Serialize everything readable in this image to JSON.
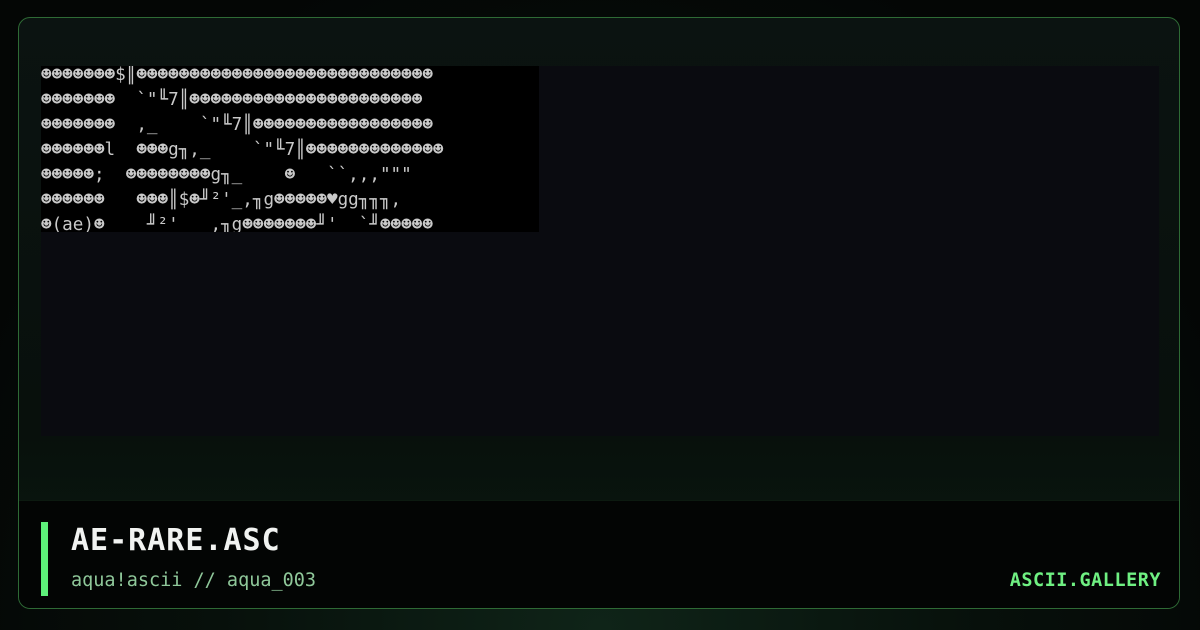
{
  "art": {
    "file_title": "AE-RARE.ASC",
    "ascii_lines": [
      "☻☻☻☻☻☻☻$║☻☻☻☻☻☻☻☻☻☻☻☻☻☻☻☻☻☻☻☻☻☻☻☻☻☻☻☻",
      "☻☻☻☻☻☻☻  `\"╙7║☻☻☻☻☻☻☻☻☻☻☻☻☻☻☻☻☻☻☻☻☻☻",
      "☻☻☻☻☻☻☻  ,_    `\"╙7║☻☻☻☻☻☻☻☻☻☻☻☻☻☻☻☻☻",
      "☻☻☻☻☻☻l  ☻☻☻g╖,_    `\"╙7║☻☻☻☻☻☻☻☻☻☻☻☻☻",
      "☻☻☻☻☻;  ☻☻☻☻☻☻☻☻g╖_    ☻   ``,,,\"\"\"",
      "☻☻☻☻☻☻   ☻☻☻║$☻╜²'_,╖g☻☻☻☻☻♥gg╖╖╖,",
      "☻(ae)☻    ╜²'   ,╖g☻☻☻☻☻☻☻╜'  `╜☻☻☻☻☻"
    ]
  },
  "footer": {
    "title": "AE-RARE.ASC",
    "subtitle": "aqua!ascii // aqua_003",
    "brand": "ASCII.GALLERY"
  },
  "colors": {
    "accent": "#5ef07a",
    "frame_border": "#2e6a35",
    "ascii_text": "#c9c9c9"
  }
}
